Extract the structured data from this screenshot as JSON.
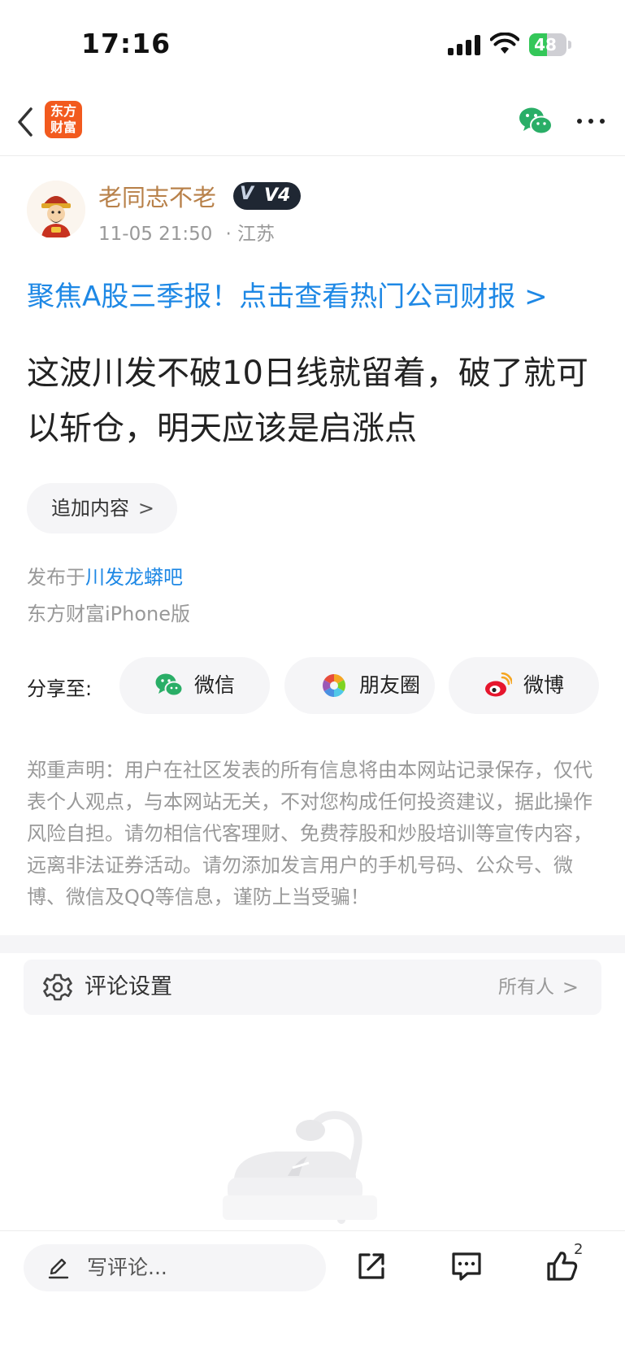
{
  "status_bar": {
    "time": "17:16",
    "battery": "48",
    "battery_level": 0.48
  },
  "nav": {
    "logo_line1": "东方",
    "logo_line2": "财富"
  },
  "author": {
    "name": "老同志不老",
    "badge_level": "V4",
    "datetime": "11-05 21:50",
    "location": "· 江苏"
  },
  "promo_link": "聚焦A股三季报！点击查看热门公司财报 >",
  "post": {
    "body": "这波川发不破10日线就留着，破了就可以斩仓，明天应该是启涨点"
  },
  "append_button": {
    "label": "追加内容",
    "chevron": ">"
  },
  "publish": {
    "prefix": "发布于",
    "bar_name": "川发龙蟒吧",
    "client": "东方财富iPhone版"
  },
  "share": {
    "label": "分享至:",
    "targets": [
      {
        "label": "微信",
        "icon": "wechat-icon"
      },
      {
        "label": "朋友圈",
        "icon": "moments-icon"
      },
      {
        "label": "微博",
        "icon": "weibo-icon"
      }
    ]
  },
  "disclaimer": "郑重声明：用户在社区发表的所有信息将由本网站记录保存，仅代表个人观点，与本网站无关，不对您构成任何投资建议，据此操作风险自担。请勿相信代客理财、免费荐股和炒股培训等宣传内容，远离非法证券活动。请勿添加发言用户的手机号码、公众号、微博、微信及QQ等信息，谨防上当受骗！",
  "comment_settings": {
    "label": "评论设置",
    "value": "所有人",
    "chevron": ">"
  },
  "toolbar": {
    "comment_placeholder": "写评论...",
    "like_count": "2"
  },
  "colors": {
    "accent_blue": "#1e88e5",
    "username": "#b8814a",
    "brand_orange": "#f25a1e",
    "wechat_green": "#2aae67"
  }
}
